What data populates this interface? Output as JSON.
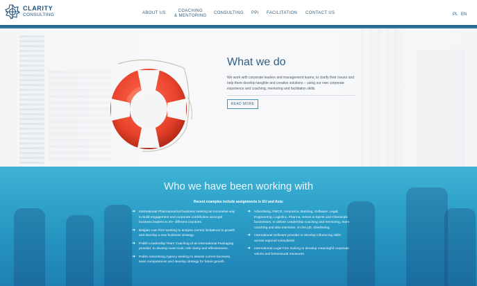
{
  "logo": {
    "line1": "CLARITY",
    "line2": "CONSULTING"
  },
  "nav": [
    {
      "label": "ABOUT US"
    },
    {
      "label": "COACHING\n& MENTORING"
    },
    {
      "label": "CONSULTING"
    },
    {
      "label": "PPI"
    },
    {
      "label": "FACILITATION"
    },
    {
      "label": "CONTACT US"
    }
  ],
  "languages": [
    "PL",
    "EN"
  ],
  "what_we_do": {
    "title": "What we do",
    "text": "We work with corporate leaders and management teams, to clarify their issues and help them develop tangible and creative solutions – using our own corporate experience and coaching, mentoring and facilitation skills.",
    "button": "READ MORE"
  },
  "clients": {
    "title": "Who we have been working with",
    "subtitle": "Recent examples include assignments in EU and Asia:",
    "left": [
      "International Pharmaceutical business seeking an innovative way to build engagement and corporate contribution amongst business leaders in 20+ different countries.",
      "Belgian Law Firm seeking to analyse current limitations to growth and develop a new business strategy.",
      "Polish Leadership Team Coaching of an International Packaging provider, to develop team trust, role clarity and effectiveness.",
      "Polish Advertising Agency seeking to assess current business, team competences and develop strategy for future growth."
    ],
    "right": [
      "Advertising, FMCG, Insurance, Banking, Software, Legal, Engineering, Logistics, Pharma, Wines & Spirits and Chemicals businesses, to deliver Leadership coaching and mentoring, team coaching and also intensive, on the job, shadowing.",
      "International Software provider to develop influencing skills across regional consultants.",
      "International Legal Firm looking to develop meaningful corporate values and behavioural measures."
    ]
  },
  "colors": {
    "brand": "#1c4f7a",
    "accent": "#3d93b8",
    "lifebuoy": "#e8432b"
  }
}
